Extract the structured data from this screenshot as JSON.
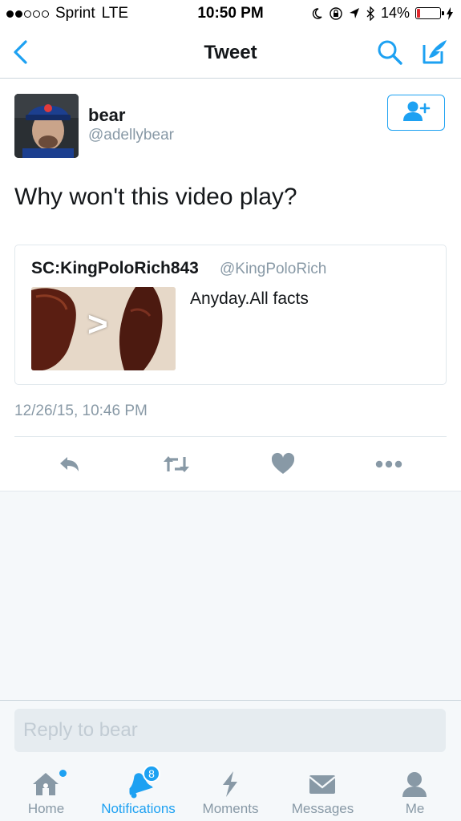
{
  "status": {
    "carrier": "Sprint",
    "network": "LTE",
    "time": "10:50 PM",
    "battery": "14%",
    "battery_level": 0.14
  },
  "nav": {
    "title": "Tweet"
  },
  "tweet": {
    "author_name": "bear",
    "author_handle": "@adellybear",
    "text": "Why won't this video play?",
    "quoted": {
      "author_name": "SC:KingPoloRich843",
      "author_handle": "@KingPoloRich",
      "text": "Anyday.All facts",
      "media_overlay": ">"
    },
    "timestamp": "12/26/15, 10:46 PM"
  },
  "reply": {
    "placeholder": "Reply to bear"
  },
  "tabs": [
    {
      "label": "Home",
      "icon": "home-icon"
    },
    {
      "label": "Notifications",
      "icon": "bell-icon",
      "badge": "8"
    },
    {
      "label": "Moments",
      "icon": "lightning-icon"
    },
    {
      "label": "Messages",
      "icon": "envelope-icon"
    },
    {
      "label": "Me",
      "icon": "person-icon"
    }
  ],
  "colors": {
    "accent": "#1da1f2",
    "muted": "#8899a6",
    "text": "#14171a",
    "battery_low": "#e0282e"
  }
}
